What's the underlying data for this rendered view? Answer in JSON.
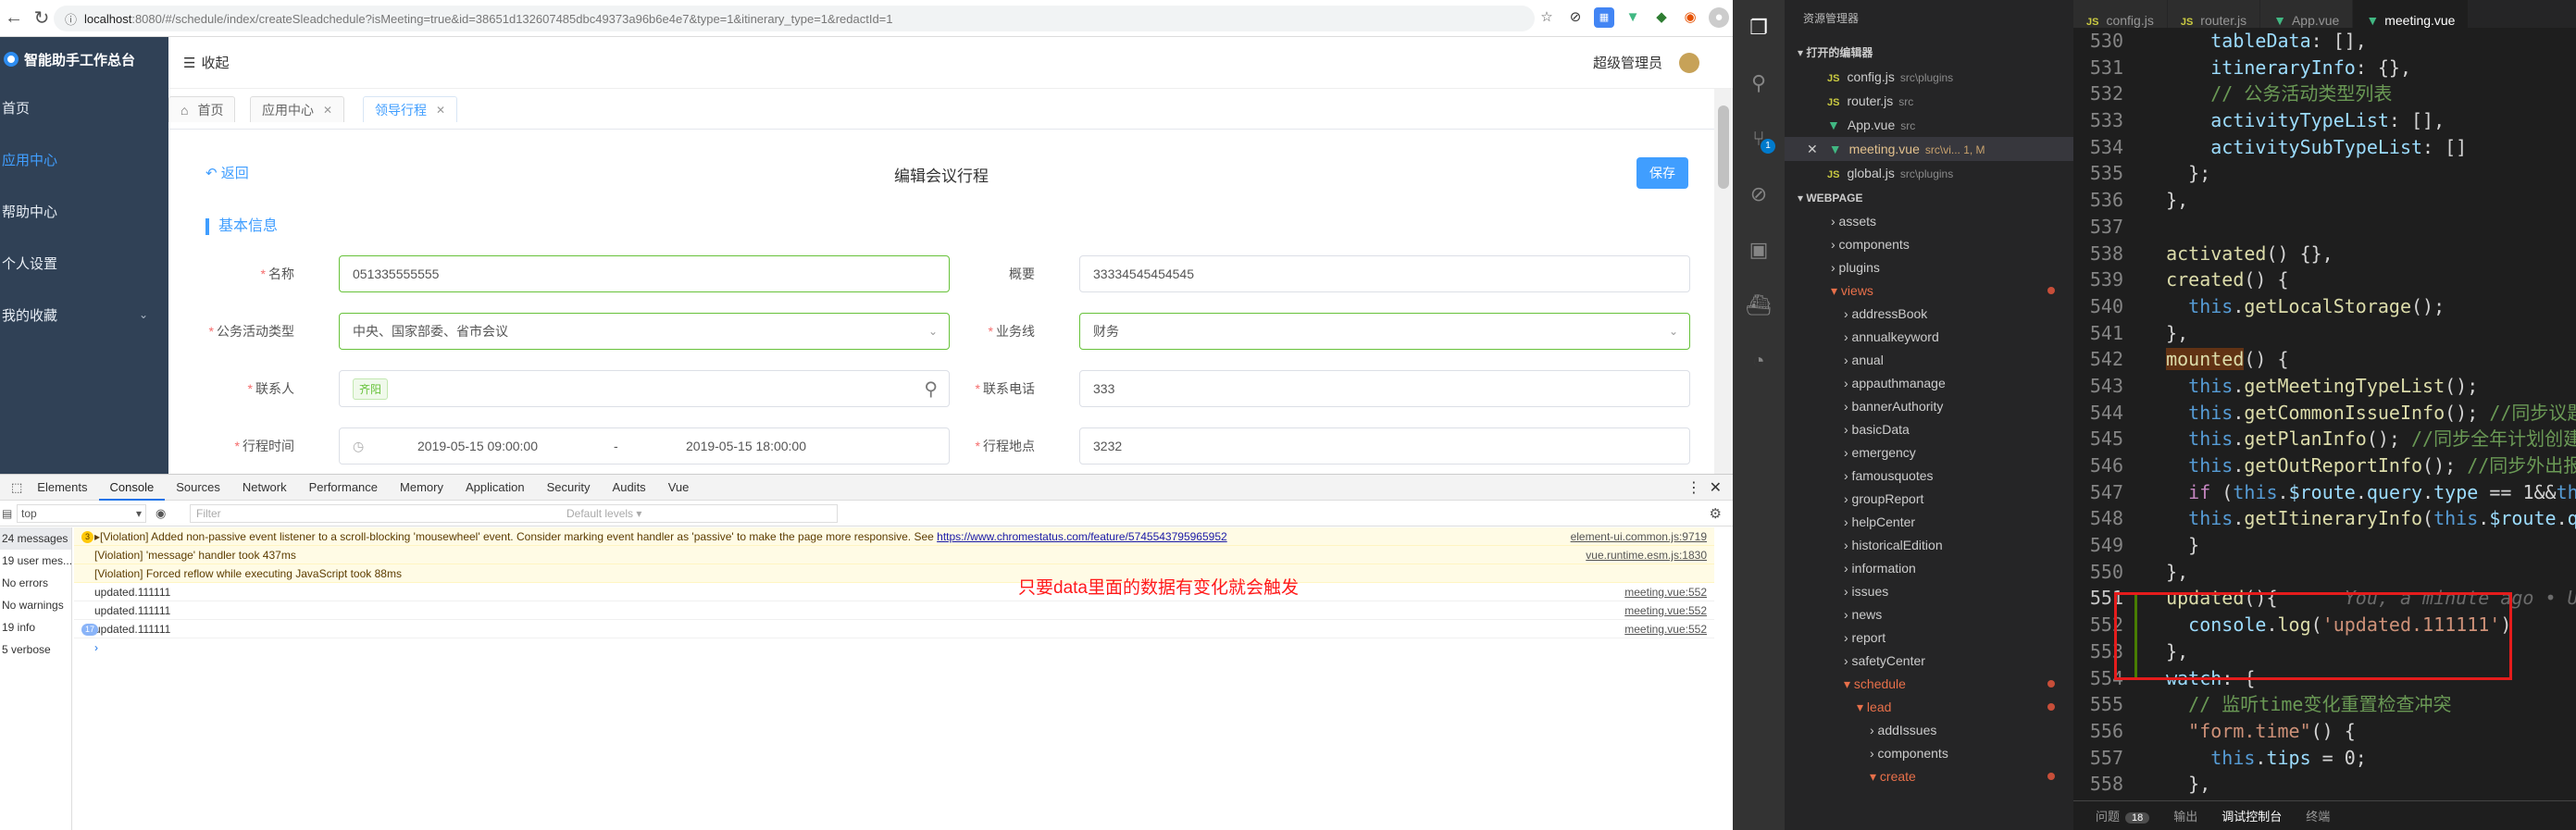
{
  "browser": {
    "url_host": "localhost",
    "url_rest": ":8080/#/schedule/index/createSleadchedule?isMeeting=true&id=38651d132607485dbc49373a96b6e4e7&type=1&itinerary_type=1&redactId=1"
  },
  "app": {
    "name": "智能助手工作总台",
    "collapse_label": "收起",
    "user_label": "超级管理员"
  },
  "sidebar": {
    "items": [
      {
        "label": "首页"
      },
      {
        "label": "应用中心"
      },
      {
        "label": "帮助中心"
      },
      {
        "label": "个人设置"
      },
      {
        "label": "我的收藏"
      }
    ]
  },
  "page_tabs": [
    {
      "label": "首页"
    },
    {
      "label": "应用中心"
    },
    {
      "label": "领导行程"
    }
  ],
  "form": {
    "back_label": "返回",
    "title": "编辑会议行程",
    "save_label": "保存",
    "section_title": "基本信息",
    "name_label": "名称",
    "name_value": "051335555555",
    "summary_label": "概要",
    "summary_value": "33334545454545",
    "activity_type_label": "公务活动类型",
    "activity_type_value": "中央、国家部委、省市会议",
    "business_line_label": "业务线",
    "business_line_value": "财务",
    "contact_label": "联系人",
    "contact_tag": "齐阳",
    "phone_label": "联系电话",
    "phone_value": "333",
    "time_label": "行程时间",
    "time_start": "2019-05-15 09:00:00",
    "time_sep": "-",
    "time_end": "2019-05-15 18:00:00",
    "place_label": "行程地点",
    "place_value": "3232"
  },
  "devtools": {
    "tabs": [
      "Elements",
      "Console",
      "Sources",
      "Network",
      "Performance",
      "Memory",
      "Application",
      "Security",
      "Audits",
      "Vue"
    ],
    "context": "top",
    "filter_placeholder": "Filter",
    "levels": "Default levels ▾",
    "sidebar": [
      "24 messages",
      "19 user mes...",
      "No errors",
      "No warnings",
      "19 info",
      "5 verbose"
    ],
    "logs": [
      {
        "count": "3",
        "text": "▸[Violation] Added non-passive event listener to a scroll-blocking 'mousewheel' event. Consider marking event handler as 'passive' to make the page more responsive. See ",
        "link": "https://www.chromestatus.com/feature/5745543795965952",
        "src": "element-ui.common.js:9719",
        "warn": true
      },
      {
        "count": "",
        "text": "[Violation] 'message' handler took 437ms",
        "link": "",
        "src": "vue.runtime.esm.js:1830",
        "warn": true
      },
      {
        "count": "",
        "text": "[Violation] Forced reflow while executing JavaScript took 88ms",
        "link": "",
        "src": "",
        "warn": true
      },
      {
        "count": "",
        "text": "updated.111111",
        "link": "",
        "src": "meeting.vue:552",
        "warn": false
      },
      {
        "count": "",
        "text": "updated.111111",
        "link": "",
        "src": "meeting.vue:552",
        "warn": false
      },
      {
        "count": "17",
        "text": "updated.111111",
        "link": "",
        "src": "meeting.vue:552",
        "warn": false
      }
    ],
    "prompt": "›"
  },
  "annotation": "只要data里面的数据有变化就会触发",
  "vscode": {
    "explorer_title": "资源管理器",
    "open_editors_header": "▾ 打开的编辑器",
    "project_header": "▾ WEBPAGE",
    "open_editors": [
      {
        "name": "config.js",
        "path": "src\\plugins",
        "type": "js"
      },
      {
        "name": "router.js",
        "path": "src",
        "type": "js"
      },
      {
        "name": "App.vue",
        "path": "src",
        "type": "vue"
      },
      {
        "name": "meeting.vue",
        "path": "src\\vi... 1, M",
        "type": "vue"
      },
      {
        "name": "global.js",
        "path": "src\\plugins",
        "type": "js"
      }
    ],
    "tree": [
      "› assets",
      "› components",
      "› plugins",
      "▾ views",
      "› addressBook",
      "› annualkeyword",
      "› anual",
      "› appauthmanage",
      "› bannerAuthority",
      "› basicData",
      "› emergency",
      "› famousquotes",
      "› groupReport",
      "› helpCenter",
      "› historicalEdition",
      "› information",
      "› issues",
      "› news",
      "› report",
      "› safetyCenter",
      "▾ schedule",
      "▾ lead",
      "› addIssues",
      "› components",
      "▾ create"
    ],
    "tabs": [
      {
        "name": "config.js",
        "type": "js"
      },
      {
        "name": "router.js",
        "type": "js"
      },
      {
        "name": "App.vue",
        "type": "vue"
      },
      {
        "name": "meeting.vue",
        "type": "vue"
      }
    ],
    "blame": "You, a minute ago • Unco",
    "panel": {
      "problems": "问题",
      "problems_count": "18",
      "output": "输出",
      "debug_console": "调试控制台",
      "terminal": "终端"
    }
  }
}
